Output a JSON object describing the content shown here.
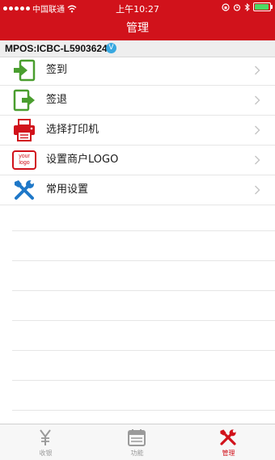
{
  "status_bar": {
    "carrier": "中国联通",
    "time": "上午10:27"
  },
  "nav": {
    "title": "管理"
  },
  "device": {
    "label": "MPOS:ICBC-L5903624",
    "badge": "V"
  },
  "menu": {
    "items": [
      {
        "label": "签到",
        "icon": "sign-in-icon"
      },
      {
        "label": "签退",
        "icon": "sign-out-icon"
      },
      {
        "label": "选择打印机",
        "icon": "printer-icon"
      },
      {
        "label": "设置商户LOGO",
        "icon": "logo-icon"
      },
      {
        "label": "常用设置",
        "icon": "tools-icon"
      }
    ]
  },
  "logo_icon_text": [
    "your",
    "logo"
  ],
  "tabs": [
    {
      "label": "收银",
      "icon": "yen-icon",
      "active": false
    },
    {
      "label": "功能",
      "icon": "calendar-icon",
      "active": false
    },
    {
      "label": "管理",
      "icon": "tools-icon",
      "active": true
    }
  ],
  "colors": {
    "brand_red": "#d1121b",
    "green_icon": "#4a9e2f",
    "blue_tools": "#1f78c8",
    "badge_blue": "#39a8e0"
  }
}
